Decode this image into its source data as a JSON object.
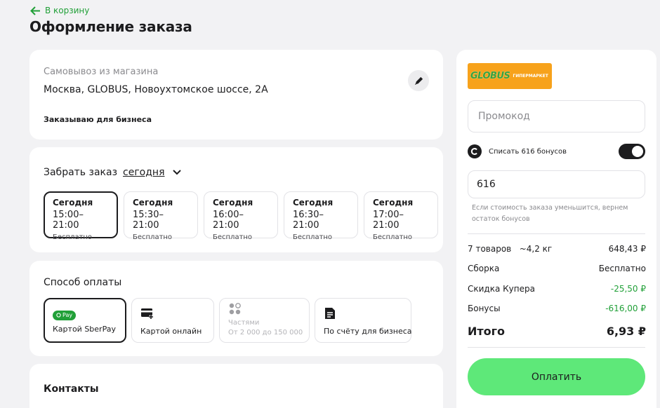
{
  "nav": {
    "back_label": "В корзину"
  },
  "page": {
    "title": "Оформление заказа"
  },
  "delivery": {
    "method": "Самовывоз из магазина",
    "address": "Москва, GLOBUS, Новоухтомское шоссе, 2А",
    "business_label": "Заказываю для бизнеса"
  },
  "pickup_time": {
    "label": "Забрать заказ",
    "day_link": "сегодня",
    "slots": [
      {
        "day": "Сегодня",
        "time": "15:00–21:00",
        "price": "Бесплатно",
        "selected": true
      },
      {
        "day": "Сегодня",
        "time": "15:30–21:00",
        "price": "Бесплатно",
        "selected": false
      },
      {
        "day": "Сегодня",
        "time": "16:00–21:00",
        "price": "Бесплатно",
        "selected": false
      },
      {
        "day": "Сегодня",
        "time": "16:30–21:00",
        "price": "Бесплатно",
        "selected": false
      },
      {
        "day": "Сегодня",
        "time": "17:00–21:00",
        "price": "Бесплатно",
        "selected": false
      }
    ]
  },
  "payment": {
    "title": "Способ оплаты",
    "options": [
      {
        "label": "Картой SberPay",
        "badge": "Pay",
        "icon": "sberpay-icon",
        "selected": true
      },
      {
        "label": "Картой онлайн",
        "icon": "card-plus-icon",
        "selected": false
      },
      {
        "label": "Частями",
        "sub": "От 2 000 до 150 000",
        "icon": "installments-icon",
        "disabled": true
      },
      {
        "label": "По счёту для бизнеса",
        "icon": "invoice-icon",
        "selected": false
      }
    ]
  },
  "contacts": {
    "title": "Контакты"
  },
  "summary": {
    "store_logo_text": "GLOBUS",
    "store_logo_sub": "ГИПЕРМАРКЕТ",
    "promo_placeholder": "Промокод",
    "bonus_toggle_label": "Списать 616 бонусов",
    "bonus_toggle_on": true,
    "bonus_value": "616",
    "bonus_hint": "Если стоимость заказа уменьшится, вернем остаток бонусов",
    "items_count": "7 товаров",
    "weight": "~4,2 кг",
    "items_total": "648,43 ₽",
    "assembly_label": "Сборка",
    "assembly_value": "Бесплатно",
    "discount_label": "Скидка Купера",
    "discount_value": "-25,50 ₽",
    "bonus_label": "Бонусы",
    "bonus_amount": "-616,00 ₽",
    "total_label": "Итого",
    "total_value": "6,93 ₽",
    "pay_button": "Оплатить"
  },
  "colors": {
    "brand_green": "#21a038",
    "pay_button": "#5ee879",
    "store_orange": "#f7a21b"
  }
}
